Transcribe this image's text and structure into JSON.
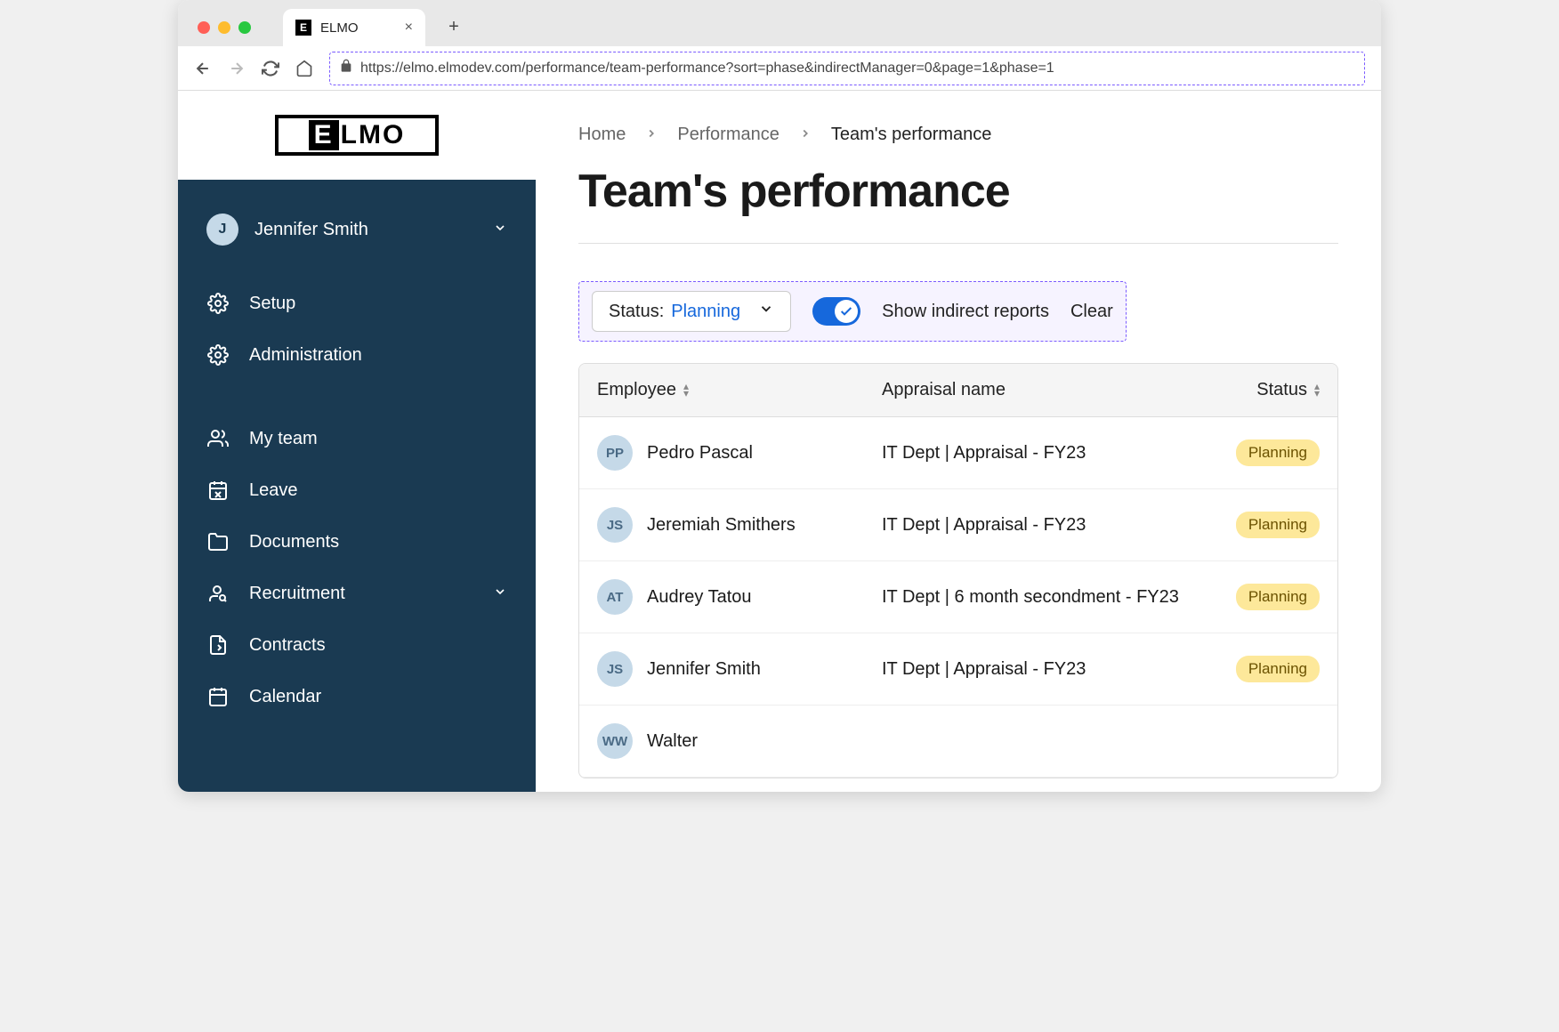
{
  "browser": {
    "tab_title": "ELMO",
    "url": "https://elmo.elmodev.com/performance/team-performance?sort=phase&indirectManager=0&page=1&phase=1"
  },
  "sidebar": {
    "logo_text_1": "E",
    "logo_text_2": "LMO",
    "user": {
      "initial": "J",
      "name": "Jennifer Smith"
    },
    "items": [
      {
        "icon": "gear",
        "label": "Setup"
      },
      {
        "icon": "gear",
        "label": "Administration"
      },
      {
        "icon": "people",
        "label": "My team"
      },
      {
        "icon": "calendar-x",
        "label": "Leave"
      },
      {
        "icon": "folder",
        "label": "Documents"
      },
      {
        "icon": "person-search",
        "label": "Recruitment",
        "expandable": true
      },
      {
        "icon": "document",
        "label": "Contracts"
      },
      {
        "icon": "calendar",
        "label": "Calendar"
      }
    ]
  },
  "breadcrumb": {
    "items": [
      "Home",
      "Performance",
      "Team's performance"
    ]
  },
  "page": {
    "title": "Team's performance"
  },
  "filters": {
    "status_label": "Status: ",
    "status_value": "Planning",
    "toggle_label": "Show indirect reports",
    "clear_label": "Clear"
  },
  "table": {
    "headers": {
      "employee": "Employee",
      "appraisal": "Appraisal name",
      "status": "Status"
    },
    "rows": [
      {
        "initials": "PP",
        "name": "Pedro Pascal",
        "appraisal": "IT Dept | Appraisal - FY23",
        "status": "Planning"
      },
      {
        "initials": "JS",
        "name": "Jeremiah Smithers",
        "appraisal": "IT Dept | Appraisal - FY23",
        "status": "Planning"
      },
      {
        "initials": "AT",
        "name": "Audrey Tatou",
        "appraisal": "IT Dept | 6 month secondment - FY23",
        "status": "Planning"
      },
      {
        "initials": "JS",
        "name": "Jennifer Smith",
        "appraisal": "IT Dept | Appraisal - FY23",
        "status": "Planning"
      },
      {
        "initials": "WW",
        "name": "Walter",
        "appraisal": "",
        "status": ""
      }
    ]
  }
}
